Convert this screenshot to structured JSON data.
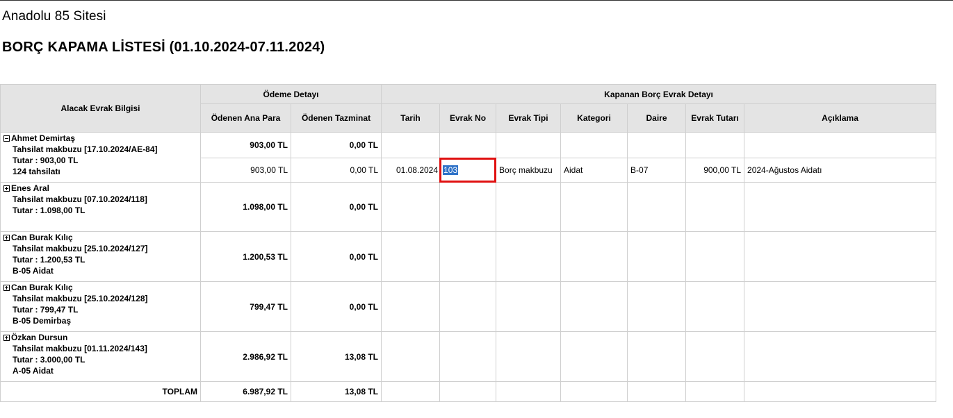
{
  "header": {
    "site_name": "Anadolu 85 Sitesi",
    "report_title": "BORÇ KAPAMA LİSTESİ (01.10.2024-07.11.2024)"
  },
  "columns": {
    "group_alacak": "Alacak Evrak Bilgisi",
    "group_odeme": "Ödeme Detayı",
    "group_kapanan": "Kapanan Borç Evrak Detayı",
    "odenen_ana_para": "Ödenen Ana Para",
    "odenen_tazminat": "Ödenen Tazminat",
    "tarih": "Tarih",
    "evrak_no": "Evrak No",
    "evrak_tipi": "Evrak Tipi",
    "kategori": "Kategori",
    "daire": "Daire",
    "evrak_tutari": "Evrak Tutarı",
    "aciklama": "Açıklama"
  },
  "rows": [
    {
      "expanded": true,
      "name": "Ahmet Demirtaş",
      "doc": "Tahsilat makbuzu [17.10.2024/AE-84]",
      "amount": "Tutar : 903,00 TL",
      "note": "124 tahsilatı",
      "ana_para": "903,00 TL",
      "tazminat": "0,00 TL",
      "detail": {
        "ana_para": "903,00 TL",
        "tazminat": "0,00 TL",
        "tarih": "01.08.2024",
        "evrak_no": "103",
        "evrak_tipi": "Borç makbuzu",
        "kategori": "Aidat",
        "daire": "B-07",
        "evrak_tutari": "900,00 TL",
        "aciklama": "2024-Ağustos Aidatı"
      }
    },
    {
      "expanded": false,
      "name": "Enes Aral",
      "doc": "Tahsilat makbuzu [07.10.2024/118]",
      "amount": "Tutar : 1.098,00 TL",
      "note": "",
      "ana_para": "1.098,00 TL",
      "tazminat": "0,00 TL"
    },
    {
      "expanded": false,
      "name": "Can Burak Kılıç",
      "doc": "Tahsilat makbuzu [25.10.2024/127]",
      "amount": "Tutar : 1.200,53 TL",
      "note": "B-05 Aidat",
      "ana_para": "1.200,53 TL",
      "tazminat": "0,00 TL"
    },
    {
      "expanded": false,
      "name": "Can Burak Kılıç",
      "doc": "Tahsilat makbuzu [25.10.2024/128]",
      "amount": "Tutar : 799,47 TL",
      "note": "B-05 Demirbaş",
      "ana_para": "799,47 TL",
      "tazminat": "0,00 TL"
    },
    {
      "expanded": false,
      "name": "Özkan Dursun",
      "doc": "Tahsilat makbuzu [01.11.2024/143]",
      "amount": "Tutar : 3.000,00 TL",
      "note": "A-05 Aidat",
      "ana_para": "2.986,92 TL",
      "tazminat": "13,08 TL"
    }
  ],
  "total": {
    "label": "TOPLAM",
    "ana_para": "6.987,92 TL",
    "tazminat": "13,08 TL"
  },
  "colors": {
    "header_bg": "#e4e4e4",
    "border": "#cfcfcf",
    "highlight": "#e01010",
    "selection": "#3073c8"
  }
}
